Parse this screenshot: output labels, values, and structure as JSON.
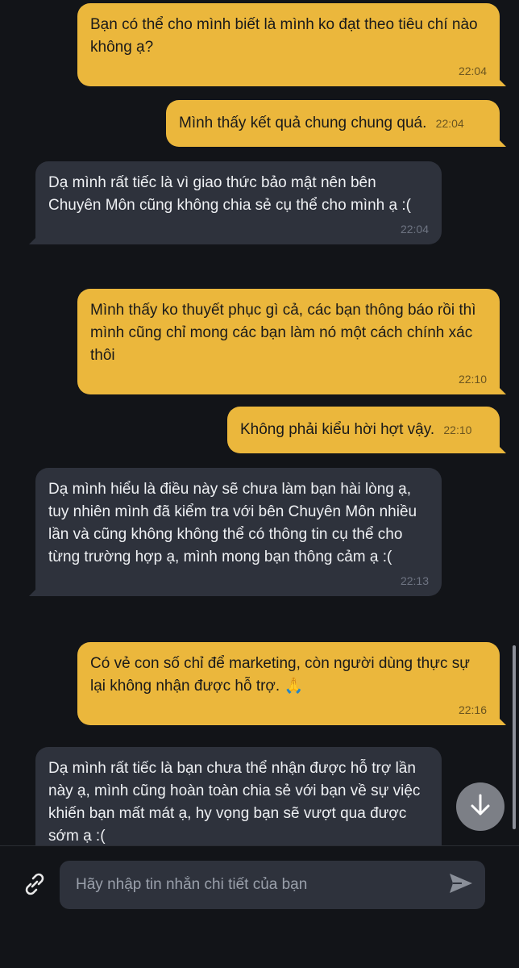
{
  "messages": [
    {
      "dir": "out",
      "text": "Bạn có thể cho mình biết là mình ko đạt theo tiêu chí nào không ạ?",
      "time": "22:04"
    },
    {
      "dir": "out",
      "text": "Mình thấy kết quả chung chung quá.",
      "time": "22:04"
    },
    {
      "dir": "in",
      "text": "Dạ mình rất tiếc là vì giao thức bảo mật nên bên Chuyên Môn cũng không chia sẻ cụ thể cho mình ạ :(",
      "time": "22:04"
    },
    {
      "dir": "out",
      "text": "Mình thấy ko thuyết phục gì cả, các bạn thông báo rồi thì mình cũng chỉ mong các bạn làm nó một cách chính xác thôi",
      "time": "22:10"
    },
    {
      "dir": "out",
      "text": "Không phải kiểu hời hợt vậy.",
      "time": "22:10"
    },
    {
      "dir": "in",
      "text": "Dạ mình hiểu là điều này sẽ chưa làm bạn hài lòng ạ, tuy nhiên mình đã kiểm tra với bên Chuyên Môn nhiều lần và cũng không không thể có thông tin cụ thể cho từng trường hợp ạ, mình mong bạn thông cảm ạ :(",
      "time": "22:13"
    },
    {
      "dir": "out",
      "text": "Có vẻ con số chỉ để marketing, còn người dùng thực sự lại không nhận được hỗ trợ. 🙏",
      "time": "22:16"
    },
    {
      "dir": "in",
      "text": "Dạ mình rất tiếc là bạn chưa thể nhận được hỗ trợ lần này ạ, mình cũng hoàn toàn chia sẻ với bạn về sự việc khiến bạn mất mát ạ, hy vọng bạn sẽ vượt qua được sớm ạ :(",
      "time": ""
    }
  ],
  "composer": {
    "placeholder": "Hãy nhập tin nhắn chi tiết của bạn",
    "value": ""
  },
  "icons": {
    "attach": "link-icon",
    "send": "send-icon",
    "scroll_down": "arrow-down-icon"
  },
  "colors": {
    "background": "#121418",
    "outgoing_bubble": "#ebb73c",
    "incoming_bubble": "#2e323c",
    "scroll_button": "#7c7f86"
  }
}
